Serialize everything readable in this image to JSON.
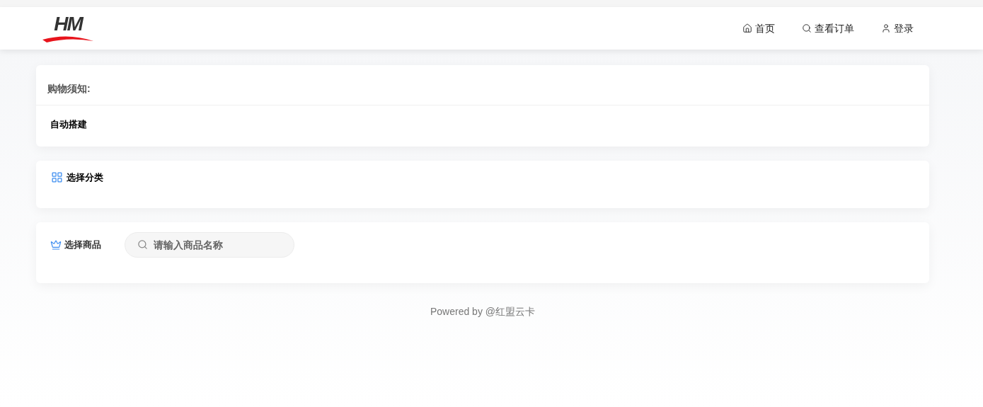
{
  "header": {
    "logo": "HM",
    "nav": [
      {
        "kind": "home",
        "label": "首页"
      },
      {
        "kind": "search",
        "label": "查看订单"
      },
      {
        "kind": "user",
        "label": "登录"
      }
    ]
  },
  "notice": {
    "title": "购物须知:",
    "body": "自动搭建"
  },
  "category": {
    "title": "选择分类"
  },
  "products": {
    "title": "选择商品",
    "search": {
      "placeholder": "请输入商品名称"
    }
  },
  "footer": "Powered by @红盟云卡"
}
